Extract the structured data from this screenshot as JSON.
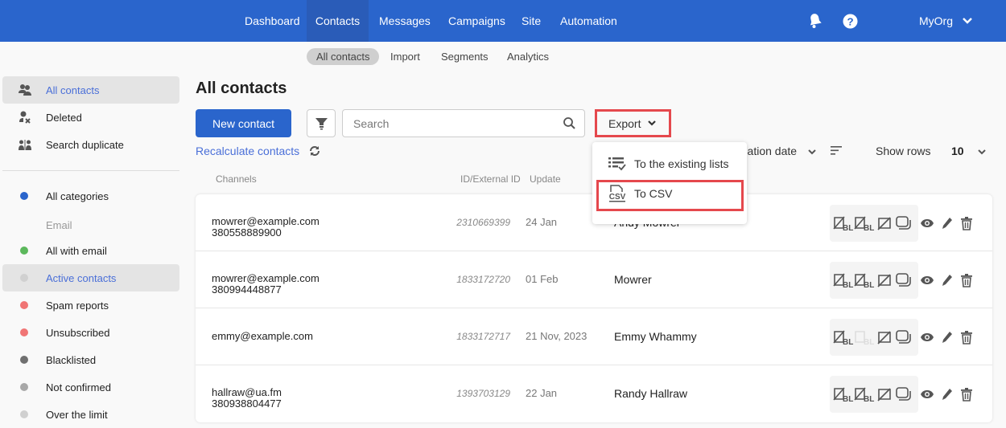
{
  "topnav": {
    "items": [
      "Dashboard",
      "Contacts",
      "Messages",
      "Campaigns",
      "Site",
      "Automation"
    ],
    "active": "Contacts",
    "org": "MyOrg",
    "brand_color": "#2a65cc"
  },
  "subnav": {
    "items": [
      "All contacts",
      "Import",
      "Segments",
      "Analytics"
    ],
    "active": "All contacts"
  },
  "sidebar": {
    "main": [
      {
        "label": "All contacts",
        "icon": "users-icon",
        "active": true
      },
      {
        "label": "Deleted",
        "icon": "user-x-icon"
      },
      {
        "label": "Search duplicate",
        "icon": "duplicate-users-icon"
      }
    ],
    "all_categories": {
      "label": "All categories",
      "color": "#2a65cc"
    },
    "group_label": "Email",
    "categories": [
      {
        "label": "All with email",
        "color": "#5cb85c"
      },
      {
        "label": "Active contacts",
        "color": "#d0d0d0",
        "active": true
      },
      {
        "label": "Spam reports",
        "color": "#f07575"
      },
      {
        "label": "Unsubscribed",
        "color": "#f07575"
      },
      {
        "label": "Blacklisted",
        "color": "#707070"
      },
      {
        "label": "Not confirmed",
        "color": "#a8a8a8"
      },
      {
        "label": "Over the limit",
        "color": "#d0d0d0"
      }
    ]
  },
  "main": {
    "title": "All contacts",
    "new_contact": "New contact",
    "search_placeholder": "Search",
    "export": "Export",
    "recalculate": "Recalculate contacts",
    "sort_by": "Creation date",
    "show_rows_label": "Show rows",
    "show_rows_value": "10",
    "columns": [
      "Channels",
      "ID/External ID",
      "Update"
    ],
    "export_menu": [
      "To the existing lists",
      "To CSV"
    ],
    "rows": [
      {
        "email": "mowrer@example.com",
        "phone": "380558889900",
        "id": "2310669399",
        "update": "24 Jan",
        "name": "Andy Mowrer",
        "sms_bl_disabled": false
      },
      {
        "email": "mowrer@example.com",
        "phone": "380994448877",
        "id": "1833172720",
        "update": "01 Feb",
        "name": "Mowrer",
        "sms_bl_disabled": false
      },
      {
        "email": "emmy@example.com",
        "phone": "",
        "id": "1833172717",
        "update": "21 Nov, 2023",
        "name": "Emmy Whammy",
        "sms_bl_disabled": true
      },
      {
        "email": "hallraw@ua.fm",
        "phone": "380938804477",
        "id": "1393703129",
        "update": "22 Jan",
        "name": "Randy Hallraw",
        "sms_bl_disabled": false
      }
    ]
  }
}
